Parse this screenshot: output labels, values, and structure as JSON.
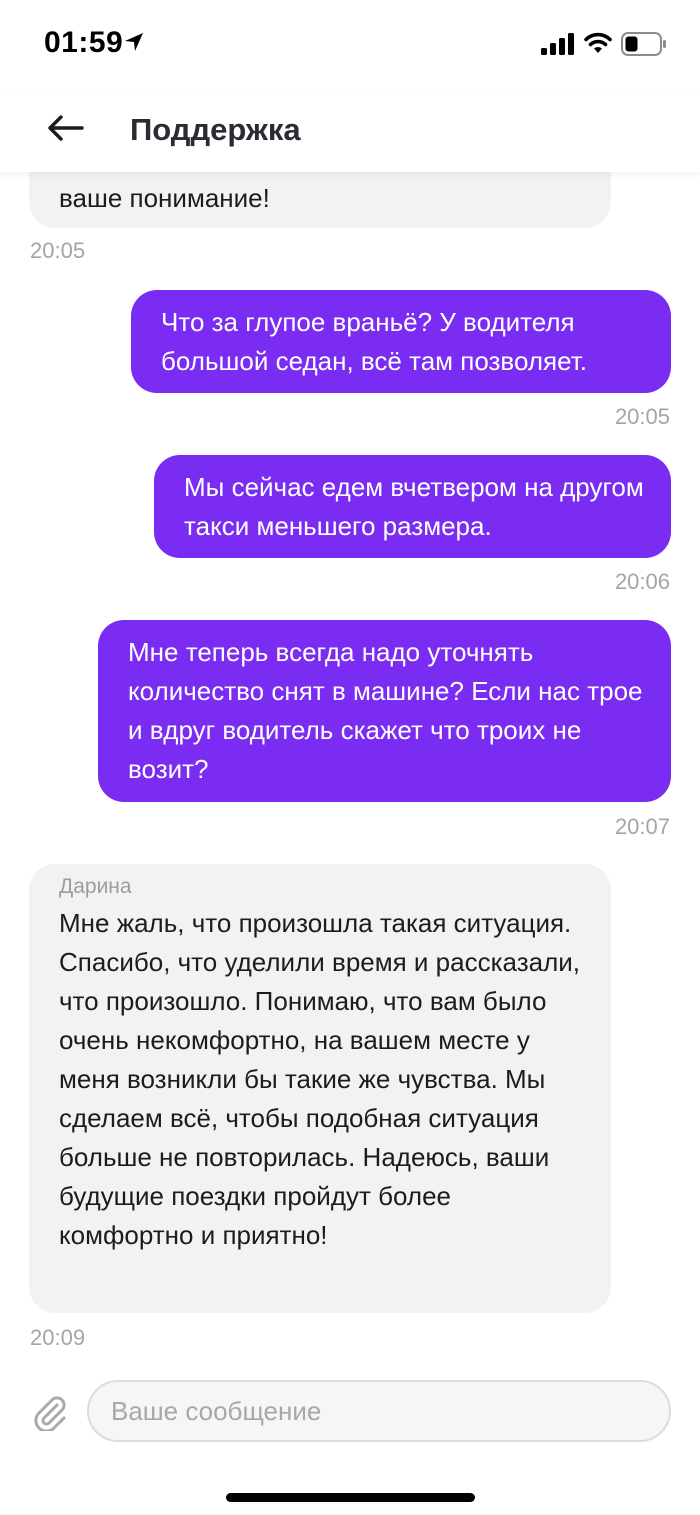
{
  "status_bar": {
    "time": "01:59"
  },
  "header": {
    "title": "Поддержка"
  },
  "messages": [
    {
      "text": "ваше понимание!",
      "time": "20:05"
    },
    {
      "text": "Что за глупое враньё? У водителя большой седан, всё там позволяет.",
      "time": "20:05"
    },
    {
      "text": "Мы сейчас едем вчетвером на другом такси меньшего размера.",
      "time": "20:06"
    },
    {
      "text": "Мне теперь всегда надо уточнять количество снят в машине? Если нас трое и вдруг водитель скажет что троих не возит?",
      "time": "20:07"
    },
    {
      "sender": "Дарина",
      "text": "Мне жаль, что произошла такая ситуация. Спасибо, что уделили время и рассказали, что произошло. Понимаю, что вам было очень некомфортно, на вашем месте у меня возникли бы такие же чувства. Мы сделаем всё, чтобы подобная ситуация больше не повторилась. Надеюсь, ваши будущие поездки пройдут более комфортно и приятно!",
      "time": "20:09"
    }
  ],
  "composer": {
    "placeholder": "Ваше сообщение"
  },
  "colors": {
    "outgoing_bubble": "#7a2cf3",
    "incoming_bubble": "#f2f2f3",
    "timestamp": "#a4a4a9"
  },
  "icons": [
    "location-arrow-icon",
    "signal-icon",
    "wifi-icon",
    "battery-icon",
    "back-arrow-icon",
    "paperclip-icon"
  ]
}
